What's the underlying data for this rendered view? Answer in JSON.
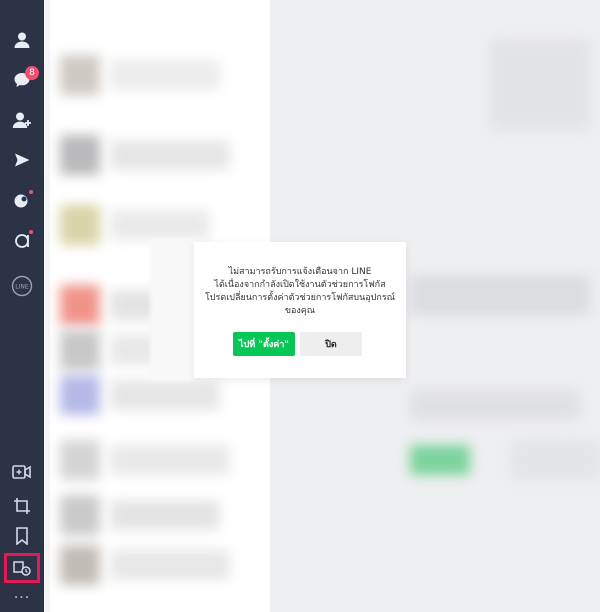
{
  "sidebar": {
    "items": [
      {
        "icon": "profile-icon"
      },
      {
        "icon": "chat-icon",
        "badge": "8"
      },
      {
        "icon": "add-friend-icon"
      },
      {
        "icon": "voom-icon"
      },
      {
        "icon": "openchat-icon"
      },
      {
        "icon": "a-icon"
      },
      {
        "icon": "line-icon",
        "label": "LINE"
      }
    ],
    "bottom_items": [
      {
        "icon": "video-call-icon"
      },
      {
        "icon": "crop-icon"
      },
      {
        "icon": "bookmark-icon"
      },
      {
        "icon": "notification-settings-icon"
      }
    ],
    "more": "···"
  },
  "dialog": {
    "line1": "ไม่สามารถรับการแจ้งเตือนจาก LINE",
    "line2": "ได้เนื่องจากกำลังเปิดใช้งานตัวช่วยการโฟกัส",
    "line3": "โปรดเปลี่ยนการตั้งค่าตัวช่วยการโฟกัสบนอุปกรณ์",
    "line4": "ของคุณ",
    "primary_button": "ไปที่ \"ตั้งค่า\"",
    "secondary_button": "ปิด"
  },
  "colors": {
    "sidebar": "#2c3346",
    "primary": "#06c755",
    "badge": "#ef4f6a",
    "highlight": "#e21a57"
  }
}
